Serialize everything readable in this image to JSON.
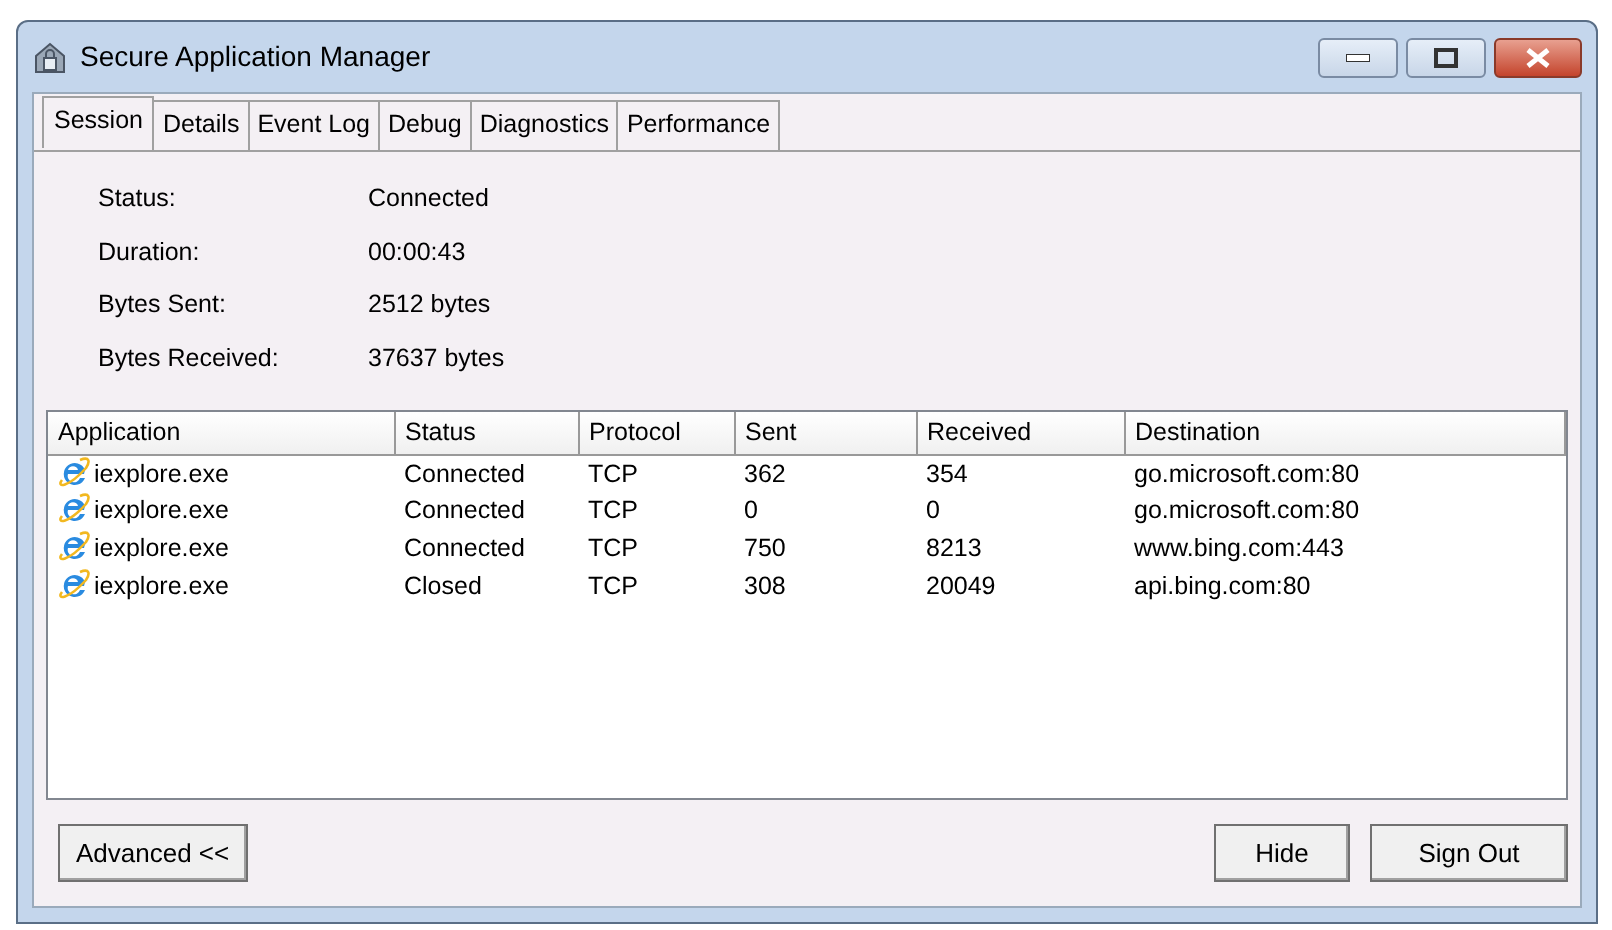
{
  "window": {
    "title": "Secure Application Manager"
  },
  "tabs": [
    {
      "label": "Session",
      "selected": true
    },
    {
      "label": "Details",
      "selected": false
    },
    {
      "label": "Event Log",
      "selected": false
    },
    {
      "label": "Debug",
      "selected": false
    },
    {
      "label": "Diagnostics",
      "selected": false
    },
    {
      "label": "Performance",
      "selected": false
    }
  ],
  "session": [
    {
      "label": "Status:",
      "value": "Connected"
    },
    {
      "label": "Duration:",
      "value": "00:00:43"
    },
    {
      "label": "Bytes Sent:",
      "value": "2512 bytes"
    },
    {
      "label": "Bytes Received:",
      "value": "37637 bytes"
    }
  ],
  "table": {
    "columns": [
      "Application",
      "Status",
      "Protocol",
      "Sent",
      "Received",
      "Destination"
    ],
    "rows": [
      [
        "iexplore.exe",
        "Connected",
        "TCP",
        "362",
        "354",
        "go.microsoft.com:80"
      ],
      [
        "iexplore.exe",
        "Connected",
        "TCP",
        "0",
        "0",
        "go.microsoft.com:80"
      ],
      [
        "iexplore.exe",
        "Connected",
        "TCP",
        "750",
        "8213",
        "www.bing.com:443"
      ],
      [
        "iexplore.exe",
        "Closed",
        "TCP",
        "308",
        "20049",
        "api.bing.com:80"
      ]
    ]
  },
  "buttons": {
    "left": "Advanced <<",
    "right": [
      "Hide",
      "Sign Out"
    ]
  }
}
